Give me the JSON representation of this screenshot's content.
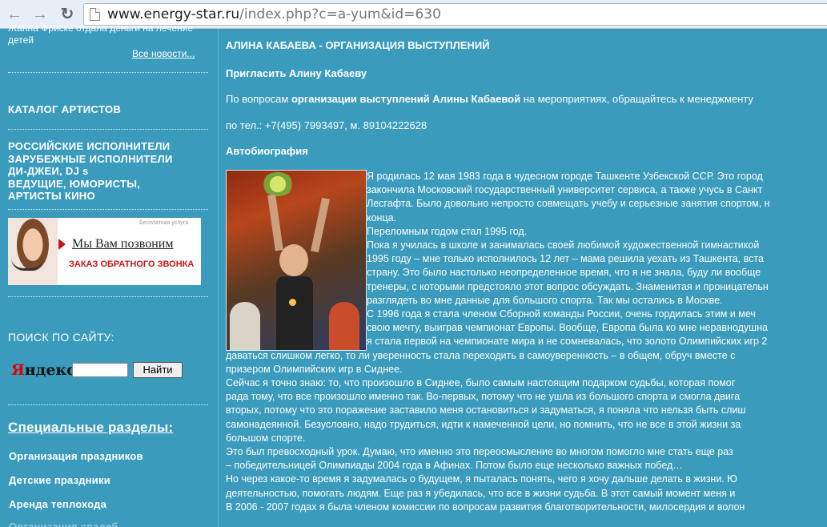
{
  "browser": {
    "url_host": "www.energy-star.ru",
    "url_path": "/index.php?c=a-yum&id=630"
  },
  "sidebar": {
    "news_snippet": "Жанна Фриске отдала деньги на лечение детей",
    "all_news": "Все новости...",
    "catalog_title": "КАТАЛОГ АРТИСТОВ",
    "catalog_items": [
      "РОССИЙСКИЕ ИСПОЛНИТЕЛИ",
      "ЗАРУБЕЖНЫЕ ИСПОЛНИТЕЛИ",
      "ДИ-ДЖЕИ, DJ s",
      "ВЕДУЩИЕ, ЮМОРИСТЫ,",
      "АРТИСТЫ КИНО"
    ],
    "banner": {
      "small": "Бесплатная услуга",
      "main": "Мы Вам позвоним",
      "sub": "ЗАКАЗ ОБРАТНОГО ЗВОНКА"
    },
    "search_label": "ПОИСК ПО САЙТУ:",
    "yandex_first": "Я",
    "yandex_rest": "ндекс",
    "search_value": "",
    "search_button": "Найти",
    "special_title": "Специальные разделы:",
    "special_items": [
      "Организация праздников",
      "Детские праздники",
      "Аренда теплохода",
      "Организация свадеб"
    ]
  },
  "main": {
    "title": "АЛИНА КАБАЕВА - ОРГАНИЗАЦИЯ ВЫСТУПЛЕНИЙ",
    "invite": "Пригласить Алину Кабаеву",
    "contact_pre": "По вопросам ",
    "contact_bold": "организации выступлений Алины Кабаевой",
    "contact_post": " на мероприятиях, обращайтесь к менеджменту",
    "phone": "по тел.: +7(495) 7993497, м. 89104222628",
    "bio_title": "Автобиография",
    "bio_wrapped": [
      "Я родилась 12 мая 1983 года в чудесном городе Ташкенте Узбекской ССР. Это город",
      "закончила Московский государственный университет сервиса, а также учусь в Санкт",
      "Лесгафта. Было довольно непросто совмещать учебу и серьезные занятия спортом, н",
      "конца.",
      "Переломным годом стал 1995 год.",
      "  Пока я училась в школе и занималась своей любимой художественной гимнастикой",
      "1995 году – мне только исполнилось 12 лет – мама решила уехать из Ташкента, вста",
      "страну. Это было настолько неопределенное время, что я не знала, буду ли вообще",
      "тренеры, с которыми предстояло этот вопрос обсуждать. Знаменитая и проницательн",
      "разглядеть во мне данные для большого спорта. Так мы остались в Москве.",
      "  С 1996 года я стала членом Сборной команды России, очень гордилась этим и меч",
      "свою мечту, выиграв чемпионат Европы. Вообще, Европа была ко мне неравнодушна",
      "я стала первой на чемпионате мира и не сомневалась, что золото Олимпийских игр 2"
    ],
    "bio_full": [
      "даваться слишком легко, то ли уверенность стала переходить в самоуверенность – в общем, обруч вместе с",
      "призером Олимпийских игр в Сиднее.",
      "  Сейчас я точно знаю: то, что произошло в Сиднее, было самым настоящим подарком судьбы, которая помог",
      "рада тому, что все произошло именно так. Во-первых, потому что не ушла из большого спорта и смогла двига",
      "вторых, потому что это поражение заставило меня остановиться и задуматься, я поняла что нельзя быть слиш",
      "самонадеянной. Безусловно, надо трудиться, идти к намеченной цели, но помнить, что не все в этой жизни за",
      "большом спорте.",
      "  Это был превосходный урок. Думаю, что именно это переосмысление во многом помогло мне стать еще раз",
      "– победительницей Олимпиады 2004 года в Афинах. Потом было еще несколько важных побед…",
      "  Но через какое-то время я задумалась о будущем, я пыталась понять, чего я хочу дальше делать в жизни. Ю",
      "деятельностью, помогать людям. Еще раз я убедилась, что все в жизни судьба. В этот самый момент меня и",
      "  В 2006 - 2007 годах я была членом комиссии по вопросам развития благотворительности, милосердия и волон"
    ]
  }
}
